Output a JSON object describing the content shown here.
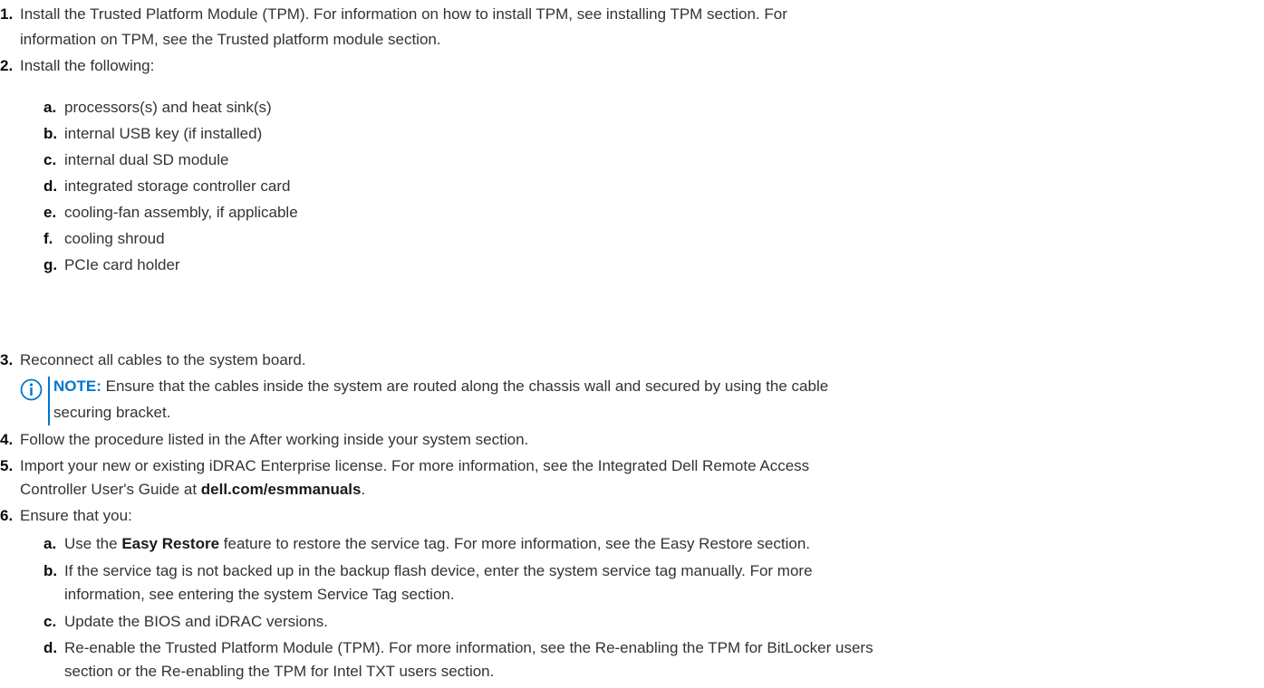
{
  "steps": [
    {
      "num": "1.",
      "lines": [
        "Install the Trusted Platform Module (TPM). For information on how to install TPM, see installing TPM section. For",
        "information on TPM, see the Trusted platform module section."
      ]
    },
    {
      "num": "2.",
      "text": "Install the following:",
      "substeps": [
        {
          "num": "a.",
          "text": "processors(s) and heat sink(s)"
        },
        {
          "num": "b.",
          "text": "internal USB key (if installed)"
        },
        {
          "num": "c.",
          "text": "internal dual SD module"
        },
        {
          "num": "d.",
          "text": "integrated storage controller card"
        },
        {
          "num": "e.",
          "text": "cooling-fan assembly, if applicable"
        },
        {
          "num": "f.",
          "text": "cooling shroud"
        },
        {
          "num": "g.",
          "text": "PCIe card holder"
        }
      ]
    },
    {
      "num": "3.",
      "text": "Reconnect all cables to the system board.",
      "note": {
        "icon": "info-icon",
        "label": "NOTE:",
        "line1": " Ensure that the cables inside the system are routed along the chassis wall and secured by using the cable",
        "line2": "securing bracket."
      }
    },
    {
      "num": "4.",
      "text": "Follow the procedure listed in the After working inside your system section."
    },
    {
      "num": "5.",
      "line1": "Import your new or existing iDRAC Enterprise license. For more information, see the Integrated Dell Remote Access",
      "line2_prefix": "Controller User's Guide at ",
      "line2_link": "dell.com/esmmanuals",
      "line2_suffix": "."
    },
    {
      "num": "6.",
      "text": "Ensure that you:",
      "substeps": [
        {
          "num": "a.",
          "prefix": "Use the ",
          "bold": "Easy Restore",
          "suffix": " feature to restore the service tag. For more information, see the Easy Restore section."
        },
        {
          "num": "b.",
          "lines": [
            "If the service tag is not backed up in the backup flash device, enter the system service tag manually. For more",
            "information, see entering the system Service Tag section."
          ]
        },
        {
          "num": "c.",
          "text": "Update the BIOS and iDRAC versions."
        },
        {
          "num": "d.",
          "lines": [
            "Re-enable the Trusted Platform Module (TPM). For more information, see the Re-enabling the TPM for BitLocker users",
            "section or the Re-enabling the TPM for Intel TXT users section."
          ]
        }
      ]
    }
  ],
  "colors": {
    "text": "#333333",
    "accent": "#0076ce"
  }
}
